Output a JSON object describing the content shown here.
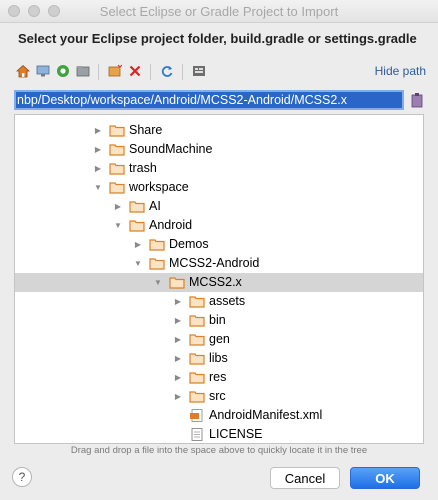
{
  "window": {
    "title": "Select Eclipse or Gradle Project to Import"
  },
  "heading": "Select your Eclipse project folder, build.gradle or settings.gradle",
  "toolbar": {
    "icons": [
      "home-icon",
      "desktop-icon",
      "android-icon",
      "project-folder-icon",
      "new-folder-icon",
      "delete-icon",
      "refresh-icon",
      "show-hidden-icon"
    ],
    "hide_path_label": "Hide path"
  },
  "path": {
    "value": "nbp/Desktop/workspace/Android/MCSS2-Android/MCSS2.x"
  },
  "tree": {
    "rows": [
      {
        "label": "Share",
        "indent": 0,
        "expanded": false,
        "type": "folder"
      },
      {
        "label": "SoundMachine",
        "indent": 0,
        "expanded": false,
        "type": "folder"
      },
      {
        "label": "trash",
        "indent": 0,
        "expanded": false,
        "type": "folder"
      },
      {
        "label": "workspace",
        "indent": 0,
        "expanded": true,
        "type": "folder"
      },
      {
        "label": "AI",
        "indent": 1,
        "expanded": false,
        "type": "folder"
      },
      {
        "label": "Android",
        "indent": 1,
        "expanded": true,
        "type": "folder"
      },
      {
        "label": "Demos",
        "indent": 2,
        "expanded": false,
        "type": "folder"
      },
      {
        "label": "MCSS2-Android",
        "indent": 2,
        "expanded": true,
        "type": "folder"
      },
      {
        "label": "MCSS2.x",
        "indent": 3,
        "expanded": true,
        "type": "folder",
        "selected": true
      },
      {
        "label": "assets",
        "indent": 4,
        "expanded": false,
        "type": "folder"
      },
      {
        "label": "bin",
        "indent": 4,
        "expanded": false,
        "type": "folder"
      },
      {
        "label": "gen",
        "indent": 4,
        "expanded": false,
        "type": "folder"
      },
      {
        "label": "libs",
        "indent": 4,
        "expanded": false,
        "type": "folder"
      },
      {
        "label": "res",
        "indent": 4,
        "expanded": false,
        "type": "folder"
      },
      {
        "label": "src",
        "indent": 4,
        "expanded": false,
        "type": "folder"
      },
      {
        "label": "AndroidManifest.xml",
        "indent": 4,
        "type": "xml-file"
      },
      {
        "label": "LICENSE",
        "indent": 4,
        "type": "text-file"
      }
    ]
  },
  "hint": "Drag and drop a file into the space above to quickly locate it in the tree",
  "buttons": {
    "help": "?",
    "cancel": "Cancel",
    "ok": "OK"
  },
  "colors": {
    "selection": "#d5d5d5",
    "path_bg": "#2966c8",
    "link": "#2c5d9f",
    "ok": "#1d6fe6",
    "folder": "#d9822b"
  }
}
